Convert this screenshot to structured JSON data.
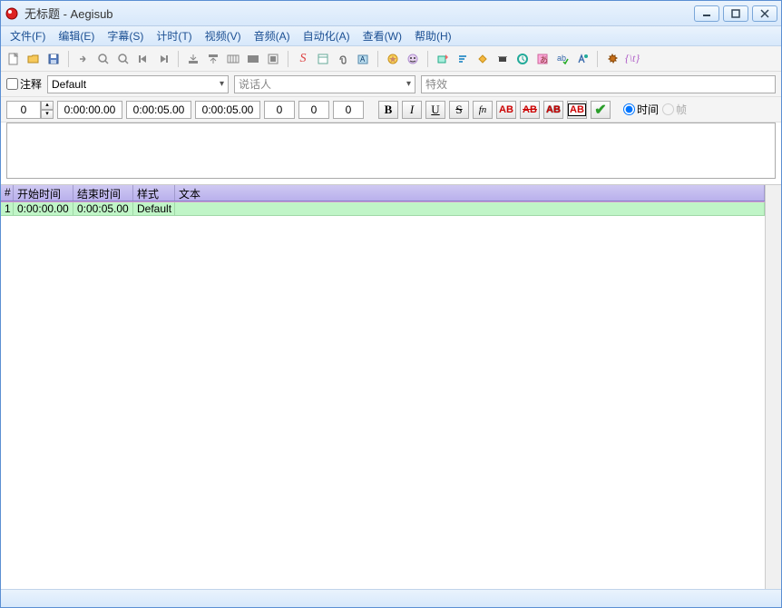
{
  "title": "无标题 - Aegisub",
  "menus": [
    "文件(F)",
    "编辑(E)",
    "字幕(S)",
    "计时(T)",
    "视频(V)",
    "音频(A)",
    "自动化(A)",
    "查看(W)",
    "帮助(H)"
  ],
  "edit": {
    "comment_label": "注释",
    "style_sel": "Default",
    "actor_placeholder": "说话人",
    "effect_placeholder": "特效",
    "layer": "0",
    "start": "0:00:00.00",
    "end": "0:00:05.00",
    "dur": "0:00:05.00",
    "ml": "0",
    "mr": "0",
    "mv": "0",
    "radio_time": "时间",
    "radio_frame": "帧"
  },
  "grid": {
    "headers": {
      "num": "#",
      "start": "开始时间",
      "end": "结束时间",
      "style": "样式",
      "text": "文本"
    },
    "rows": [
      {
        "num": "1",
        "start": "0:00:00.00",
        "end": "0:00:05.00",
        "style": "Default",
        "text": ""
      }
    ]
  }
}
